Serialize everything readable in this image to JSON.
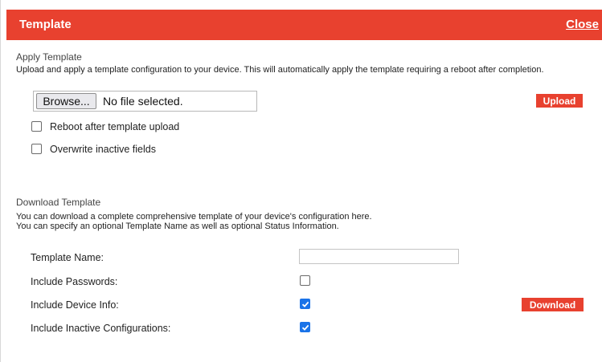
{
  "header": {
    "title": "Template",
    "close_label": "Close"
  },
  "apply": {
    "heading": "Apply Template",
    "description": "Upload and apply a template configuration to your device. This will automatically apply the template requiring a reboot after completion.",
    "browse_label": "Browse...",
    "file_status": "No file selected.",
    "upload_label": "Upload",
    "options": [
      {
        "label": "Reboot after template upload",
        "checked": false
      },
      {
        "label": "Overwrite inactive fields",
        "checked": false
      }
    ]
  },
  "download": {
    "heading": "Download Template",
    "description_line1": "You can download a complete comprehensive template of your device's configuration here.",
    "description_line2": "You can specify an optional Template Name as well as optional Status Information.",
    "template_name_label": "Template Name:",
    "template_name_value": "",
    "rows": [
      {
        "label": "Include Passwords:",
        "checked": false
      },
      {
        "label": "Include Device Info:",
        "checked": true
      },
      {
        "label": "Include Inactive Configurations:",
        "checked": true
      }
    ],
    "download_label": "Download"
  },
  "colors": {
    "accent": "#e8412f",
    "checkbox_checked": "#1a73e8"
  }
}
